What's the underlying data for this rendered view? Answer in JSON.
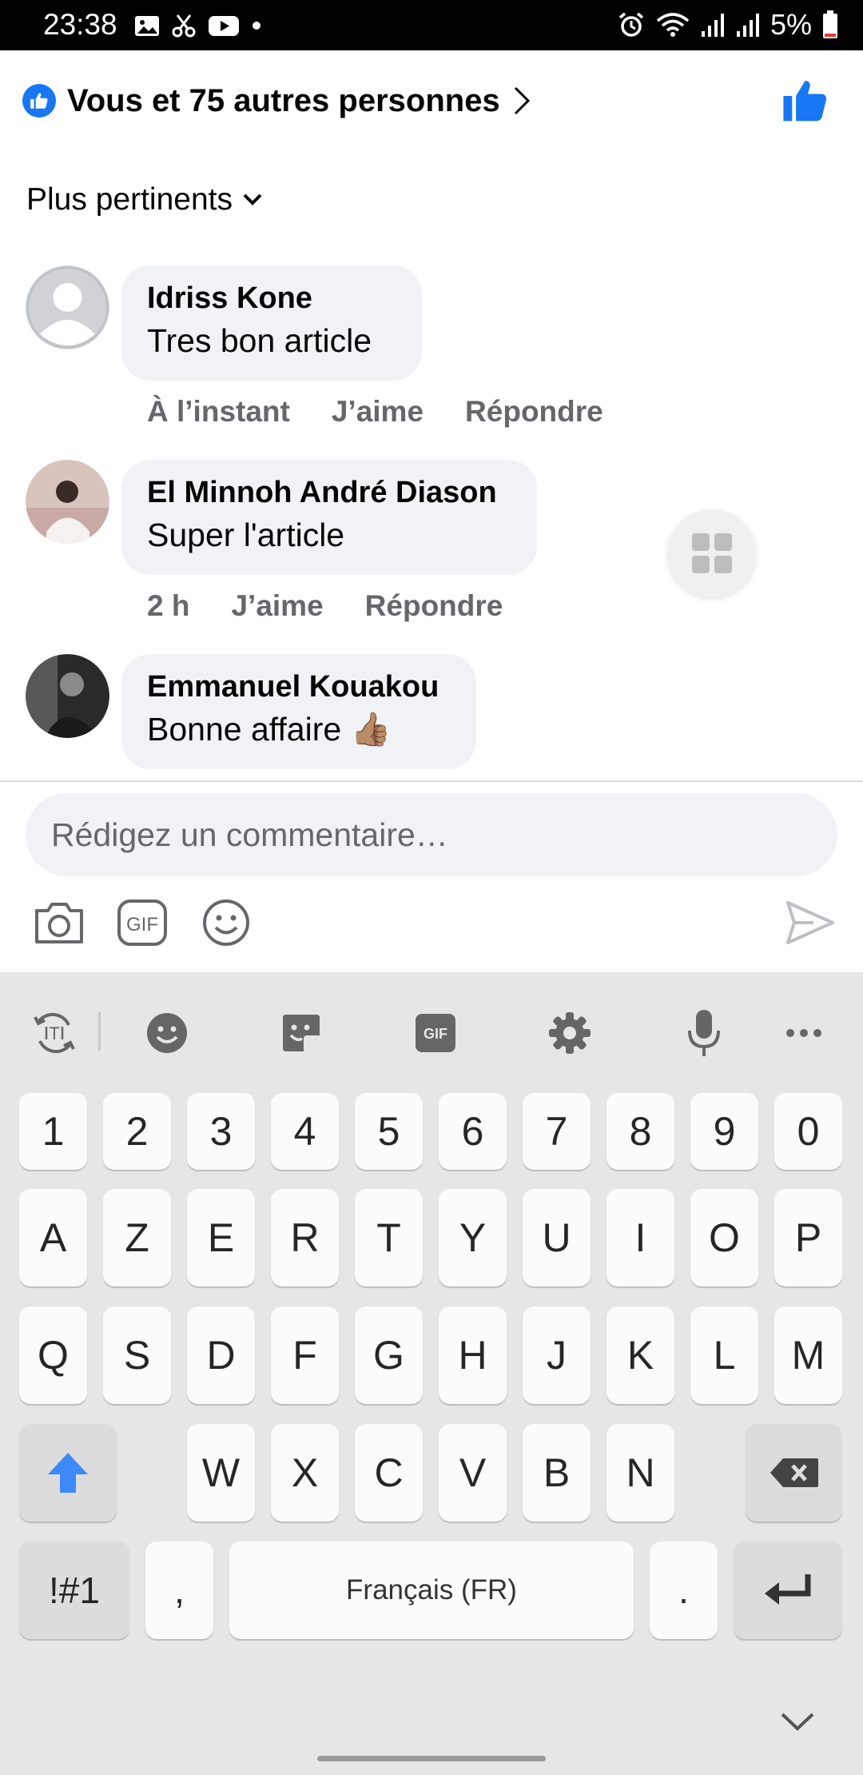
{
  "status_bar": {
    "time": "23:38",
    "battery": "5%"
  },
  "reactions": {
    "summary": "Vous et 75 autres personnes"
  },
  "sort": {
    "label": "Plus pertinents"
  },
  "comments": [
    {
      "author": "Idriss Kone",
      "text": "Tres bon article",
      "time": "À l’instant",
      "like": "J’aime",
      "reply": "Répondre"
    },
    {
      "author": "El Minnoh André Diason",
      "text": "Super l'article",
      "time": "2 h",
      "like": "J’aime",
      "reply": "Répondre"
    },
    {
      "author": "Emmanuel Kouakou",
      "text": "Bonne affaire 👍🏽",
      "time": "",
      "like": "",
      "reply": ""
    }
  ],
  "composer": {
    "placeholder": "Rédigez un commentaire…",
    "value": ""
  },
  "composer_tools": [
    "camera-icon",
    "gif-icon",
    "emoji-icon",
    "send-icon"
  ],
  "keyboard": {
    "toolbar": [
      "translate-icon",
      "emoji-icon",
      "sticker-icon",
      "gif-icon",
      "settings-icon",
      "mic-icon",
      "more-icon"
    ],
    "gif_label": "GIF",
    "row_numbers": [
      "1",
      "2",
      "3",
      "4",
      "5",
      "6",
      "7",
      "8",
      "9",
      "0"
    ],
    "row_1": [
      "A",
      "Z",
      "E",
      "R",
      "T",
      "Y",
      "U",
      "I",
      "O",
      "P"
    ],
    "row_2": [
      "Q",
      "S",
      "D",
      "F",
      "G",
      "H",
      "J",
      "K",
      "L",
      "M"
    ],
    "row_3": [
      "W",
      "X",
      "C",
      "V",
      "B",
      "N"
    ],
    "symbols_label": "!#1",
    "comma": ",",
    "space_label": "Français (FR)",
    "period": "."
  },
  "colors": {
    "facebook_blue": "#1877f2",
    "shift_blue": "#3d8af7",
    "bubble_gray": "#f0f2f5",
    "meta_gray": "#65676b"
  }
}
